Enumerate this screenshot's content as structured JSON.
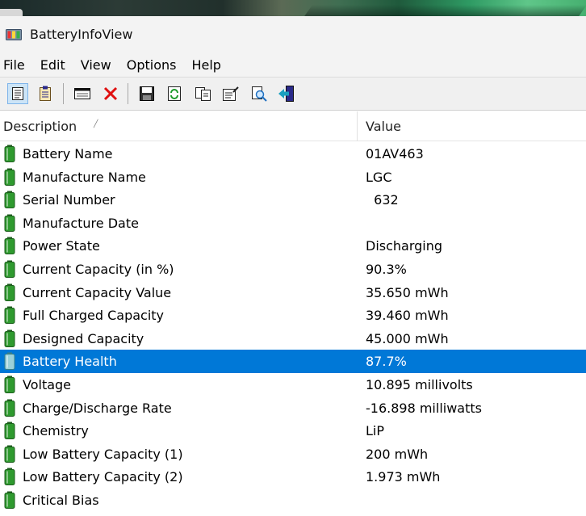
{
  "window": {
    "title": "BatteryInfoView"
  },
  "menu": [
    "File",
    "Edit",
    "View",
    "Options",
    "Help"
  ],
  "toolbar": {
    "buttons": [
      {
        "name": "normal-view-button",
        "icon": "document-lines-icon"
      },
      {
        "name": "clipboard-view-button",
        "icon": "clipboard-icon"
      },
      {
        "name": "window-button",
        "icon": "window-icon"
      },
      {
        "name": "delete-button",
        "icon": "red-x-icon"
      },
      {
        "name": "save-button",
        "icon": "floppy-disk-icon"
      },
      {
        "name": "refresh-button",
        "icon": "refresh-icon"
      },
      {
        "name": "copy-button",
        "icon": "copy-icon"
      },
      {
        "name": "properties-button",
        "icon": "properties-icon"
      },
      {
        "name": "find-button",
        "icon": "magnifier-icon"
      },
      {
        "name": "exit-button",
        "icon": "exit-door-icon"
      }
    ]
  },
  "columns": {
    "description": "Description",
    "value": "Value"
  },
  "rows": [
    {
      "description": "Battery Name",
      "value": "01AV463"
    },
    {
      "description": "Manufacture Name",
      "value": "LGC"
    },
    {
      "description": "Serial Number",
      "value": "  632"
    },
    {
      "description": "Manufacture Date",
      "value": ""
    },
    {
      "description": "Power State",
      "value": "Discharging"
    },
    {
      "description": "Current Capacity (in %)",
      "value": "90.3%"
    },
    {
      "description": "Current Capacity Value",
      "value": "35.650 mWh"
    },
    {
      "description": "Full Charged Capacity",
      "value": "39.460 mWh"
    },
    {
      "description": "Designed Capacity",
      "value": "45.000 mWh"
    },
    {
      "description": "Battery Health",
      "value": "87.7%",
      "selected": true
    },
    {
      "description": "Voltage",
      "value": "10.895 millivolts"
    },
    {
      "description": "Charge/Discharge Rate",
      "value": "-16.898 milliwatts"
    },
    {
      "description": "Chemistry",
      "value": "LiP"
    },
    {
      "description": "Low Battery Capacity (1)",
      "value": "200 mWh"
    },
    {
      "description": "Low Battery Capacity (2)",
      "value": "1.973 mWh"
    },
    {
      "description": "Critical Bias",
      "value": ""
    }
  ],
  "colors": {
    "selection": "#0078d7",
    "battery_green": "#2f9a2f"
  }
}
